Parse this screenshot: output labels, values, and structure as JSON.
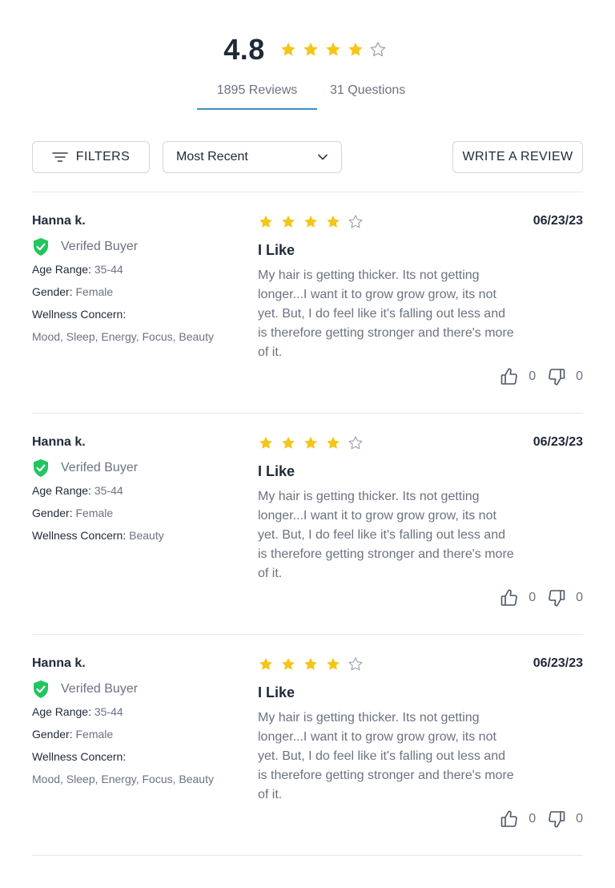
{
  "summary": {
    "rating": "4.8",
    "stars": [
      1,
      1,
      1,
      1,
      0
    ],
    "star_color": "#f5c518",
    "empty_star_color": "#9ca3af"
  },
  "tabs": [
    {
      "label": "1895 Reviews",
      "active": true
    },
    {
      "label": "31 Questions",
      "active": false
    }
  ],
  "toolbar": {
    "filters_label": "FILTERS",
    "filter_icon": "filter-lines-icon",
    "sort_value": "Most Recent",
    "sort_icon": "chevron-down-icon",
    "write_label": "WRITE A REVIEW"
  },
  "reviews": [
    {
      "name": "Hanna k.",
      "verified": "Verifed Buyer",
      "age_label": "Age Range:",
      "age": "35-44",
      "gender_label": "Gender:",
      "gender": "Female",
      "concern_label": "Wellness Concern:",
      "concern": "Mood, Sleep, Energy, Focus, Beauty",
      "stars": [
        1,
        1,
        1,
        1,
        0
      ],
      "date": "06/23/23",
      "title": "I Like",
      "body": "My hair is getting thicker. Its not getting longer...I want it to grow grow grow, its not yet. But, I do feel like it's falling out less and is therefore getting stronger and there's more of it.",
      "up": "0",
      "down": "0"
    },
    {
      "name": "Hanna k.",
      "verified": "Verifed Buyer",
      "age_label": "Age Range:",
      "age": "35-44",
      "gender_label": "Gender:",
      "gender": "Female",
      "concern_label": "Wellness Concern:",
      "concern": "Beauty",
      "stars": [
        1,
        1,
        1,
        1,
        0
      ],
      "date": "06/23/23",
      "title": "I Like",
      "body": "My hair is getting thicker. Its not getting longer...I want it to grow grow grow, its not yet. But, I do feel like it's falling out less and is therefore getting stronger and there's more of it.",
      "up": "0",
      "down": "0"
    },
    {
      "name": "Hanna k.",
      "verified": "Verifed Buyer",
      "age_label": "Age Range:",
      "age": "35-44",
      "gender_label": "Gender:",
      "gender": "Female",
      "concern_label": "Wellness Concern:",
      "concern": "Mood, Sleep, Energy, Focus, Beauty",
      "stars": [
        1,
        1,
        1,
        1,
        0
      ],
      "date": "06/23/23",
      "title": "I Like",
      "body": "My hair is getting thicker. Its not getting longer...I want it to grow grow grow, its not yet. But, I do feel like it's falling out less and is therefore getting stronger and there's more of it.",
      "up": "0",
      "down": "0"
    }
  ],
  "colors": {
    "tab_underline": "#3b8fc4",
    "verified_green": "#22c55e"
  }
}
